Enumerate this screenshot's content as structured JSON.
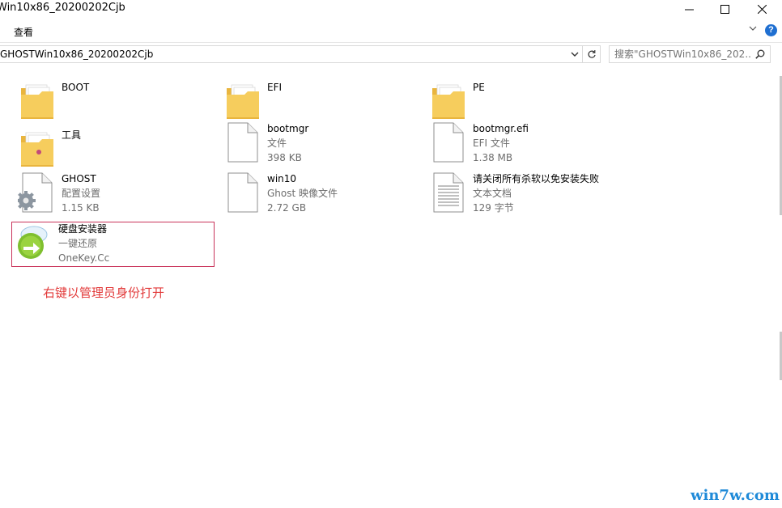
{
  "window": {
    "title": "Win10x86_20200202Cjb"
  },
  "ribbon": {
    "view_label": "查看"
  },
  "address": {
    "path": "GHOSTWin10x86_20200202Cjb"
  },
  "search": {
    "placeholder": "搜索\"GHOSTWin10x86_202...",
    "icon": "search-icon"
  },
  "items": [
    {
      "name": "BOOT",
      "type": "",
      "size": "",
      "icon": "folder-icon"
    },
    {
      "name": "EFI",
      "type": "",
      "size": "",
      "icon": "folder-icon"
    },
    {
      "name": "PE",
      "type": "",
      "size": "",
      "icon": "folder-icon"
    },
    {
      "name": "工具",
      "type": "",
      "size": "",
      "icon": "folder-icon"
    },
    {
      "name": "bootmgr",
      "type": "文件",
      "size": "398 KB",
      "icon": "file-icon"
    },
    {
      "name": "bootmgr.efi",
      "type": "EFI 文件",
      "size": "1.38 MB",
      "icon": "file-icon"
    },
    {
      "name": "GHOST",
      "type": "配置设置",
      "size": "1.15 KB",
      "icon": "config-file-icon"
    },
    {
      "name": "win10",
      "type": "Ghost 映像文件",
      "size": "2.72 GB",
      "icon": "file-icon"
    },
    {
      "name": "请关闭所有杀软以免安装失败",
      "type": "文本文档",
      "size": "129 字节",
      "icon": "text-file-icon"
    },
    {
      "name": "硬盘安装器",
      "type": "一键还原",
      "size": "OneKey.Cc",
      "icon": "installer-app-icon"
    }
  ],
  "annotation": {
    "text": "右键以管理员身份打开",
    "color": "#e23a3a"
  },
  "watermark": {
    "text": "win7w.com"
  },
  "colors": {
    "folder": "#f3c14f",
    "selection_border": "#c9335a",
    "help": "#1f6fd1",
    "watermark": "#1f8ad8"
  }
}
